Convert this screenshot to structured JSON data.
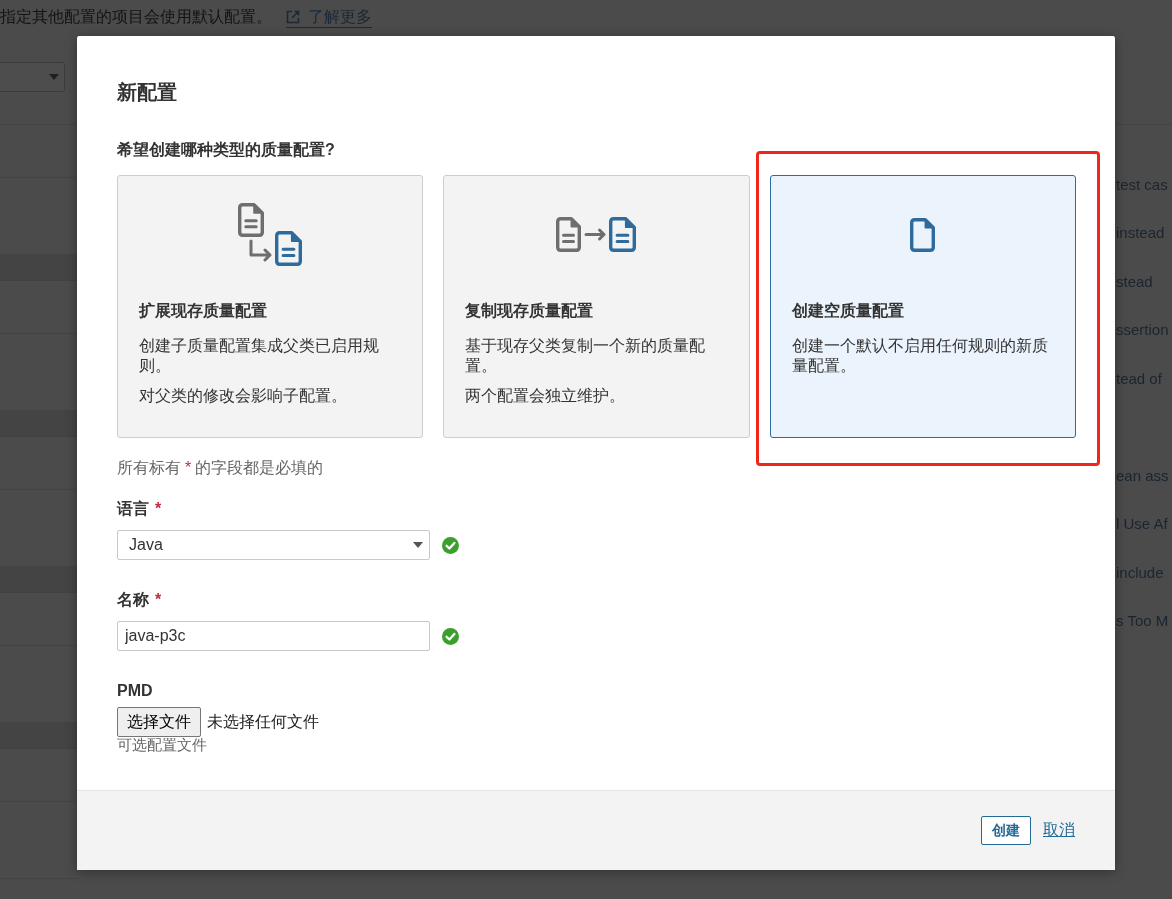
{
  "background": {
    "notice": "指定其他配置的项目会使用默认配置。",
    "learn_more_link": "了解更多",
    "rule_groups": [
      [
        "test cas",
        "instead",
        "stead",
        "ssertion",
        "tead of"
      ],
      [
        "ean ass",
        "l Use Af",
        "include",
        "s Too M"
      ]
    ]
  },
  "dialog": {
    "title": "新配置",
    "question": "希望创建哪种类型的质量配置?",
    "options": [
      {
        "kind": "extend",
        "title": "扩展现存质量配置",
        "paragraphs": [
          "创建子质量配置集成父类已启用规则。",
          "对父类的修改会影响子配置。"
        ],
        "selected": false,
        "highlighted": false
      },
      {
        "kind": "copy",
        "title": "复制现存质量配置",
        "paragraphs": [
          "基于现存父类复制一个新的质量配置。",
          "两个配置会独立维护。"
        ],
        "selected": false,
        "highlighted": false
      },
      {
        "kind": "blank",
        "title": "创建空质量配置",
        "paragraphs": [
          "创建一个默认不启用任何规则的新质量配置。"
        ],
        "selected": true,
        "highlighted": true
      }
    ],
    "required_note": {
      "before": "所有标有",
      "mark": "*",
      "after": "的字段都是必填的"
    },
    "fields": [
      {
        "kind": "select",
        "label": "语言",
        "required_mark": "*",
        "value": "Java",
        "valid": true
      },
      {
        "kind": "text",
        "label": "名称",
        "required_mark": "*",
        "value": "java-p3c",
        "valid": true
      },
      {
        "kind": "file",
        "label": "PMD",
        "button": "选择文件",
        "status": "未选择任何文件",
        "hint": "可选配置文件"
      }
    ],
    "buttons": [
      {
        "kind": "primary",
        "label": "创建"
      },
      {
        "kind": "link",
        "label": "取消"
      }
    ]
  }
}
